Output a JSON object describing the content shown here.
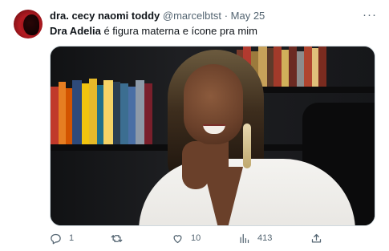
{
  "author": {
    "name": "dra. cecy naomi toddy",
    "handle": "@marcelbtst",
    "separator": "·",
    "date": "May 25"
  },
  "menu": {
    "more_label": "···"
  },
  "tweet": {
    "bold_text": "Dra Adelia",
    "rest_text": " é figura materna e ícone pra mim"
  },
  "media": {
    "icon": "photo-image"
  },
  "actions": {
    "reply_count": "1",
    "like_count": "10",
    "views_count": "413",
    "icons": [
      "reply-icon",
      "retweet-icon",
      "like-icon",
      "views-icon",
      "share-icon"
    ]
  },
  "colors": {
    "text": "#0f1419",
    "secondary": "#536471",
    "border": "#cfd9de"
  }
}
